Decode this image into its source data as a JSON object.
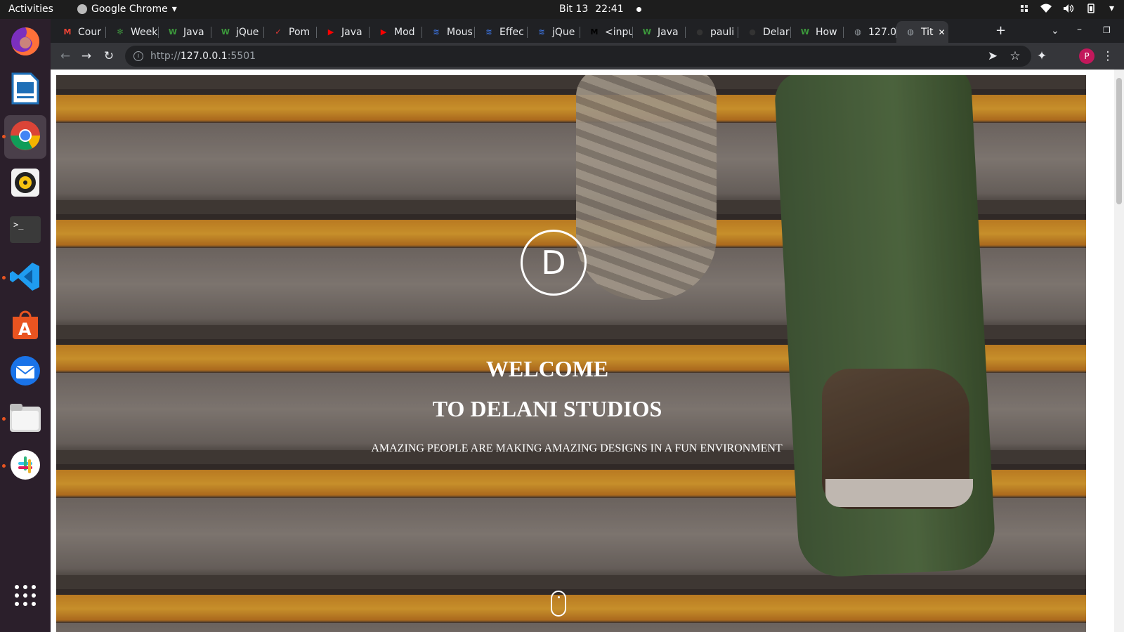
{
  "topbar": {
    "activities": "Activities",
    "app_name": "Google Chrome",
    "date": "Bit 13",
    "time": "22:41"
  },
  "browser": {
    "tabs": [
      {
        "title": "Cour",
        "icon": "gmail-icon",
        "color": "#ea4335"
      },
      {
        "title": "Week",
        "icon": "plant-icon",
        "color": "#3c8a3c"
      },
      {
        "title": "Java",
        "icon": "w-icon",
        "color": "#3c9a3c"
      },
      {
        "title": "jQue",
        "icon": "w-icon",
        "color": "#3c9a3c"
      },
      {
        "title": "Pom",
        "icon": "check-icon",
        "color": "#e53935"
      },
      {
        "title": "Java",
        "icon": "youtube-icon",
        "color": "#ff0000"
      },
      {
        "title": "Mod",
        "icon": "youtube-icon",
        "color": "#ff0000"
      },
      {
        "title": "Mous",
        "icon": "wave-icon",
        "color": "#3b6fd6"
      },
      {
        "title": "Effec",
        "icon": "wave-icon",
        "color": "#3b6fd6"
      },
      {
        "title": "jQue",
        "icon": "wave-icon",
        "color": "#3b6fd6"
      },
      {
        "title": "<inpu",
        "icon": "mdn-icon",
        "color": "#000000"
      },
      {
        "title": "Java",
        "icon": "w-icon",
        "color": "#3c9a3c"
      },
      {
        "title": "pauli",
        "icon": "github-icon",
        "color": "#333333"
      },
      {
        "title": "Delar",
        "icon": "github-icon",
        "color": "#333333"
      },
      {
        "title": "How",
        "icon": "w-icon",
        "color": "#3c9a3c"
      },
      {
        "title": "127.0",
        "icon": "globe-icon",
        "color": "#9aa0a6"
      },
      {
        "title": "Tit",
        "icon": "globe-icon",
        "color": "#9aa0a6",
        "active": true
      }
    ],
    "url_scheme": "http://",
    "url_host": "127.0.0.1",
    "url_port": ":5501",
    "profile_initial": "P"
  },
  "page": {
    "logo_letter": "D",
    "heading_line1": "WELCOME",
    "heading_line2": "TO DELANI STUDIOS",
    "tagline": "AMAZING PEOPLE ARE MAKING AMAZING DESIGNS IN A FUN ENVIRONMENT"
  },
  "dock": {
    "items": [
      "firefox-icon",
      "writer-icon",
      "chrome-icon",
      "rhythmbox-icon",
      "terminal-icon",
      "vscode-icon",
      "software-icon",
      "thunderbird-icon",
      "files-icon",
      "slack-icon",
      "apps-grid-icon"
    ]
  },
  "colors": {
    "accent": "#e95420",
    "chrome_dark": "#202124"
  }
}
